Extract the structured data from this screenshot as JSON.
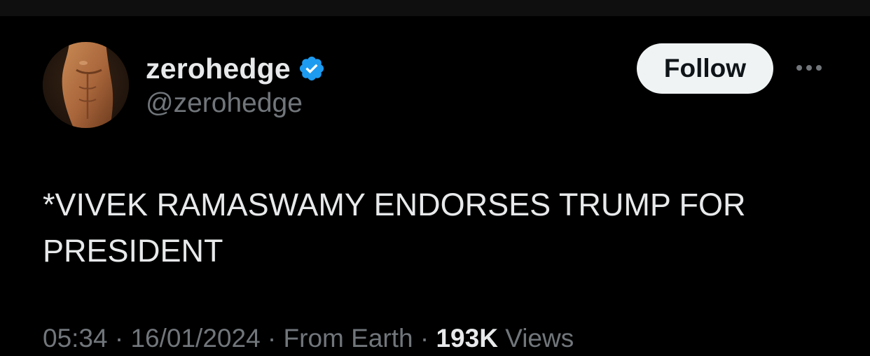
{
  "author": {
    "display_name": "zerohedge",
    "handle": "@zerohedge",
    "verified": true,
    "verified_icon": "verified-badge-icon",
    "verified_color": "#1d9bf0"
  },
  "actions": {
    "follow_label": "Follow",
    "more_icon": "more-horizontal-icon"
  },
  "tweet": {
    "text": "*VIVEK RAMASWAMY ENDORSES TRUMP FOR PRESIDENT",
    "time": "05:34 · 16/01/2024",
    "via": " · From Earth · ",
    "views": "193K",
    "views_label": " Views"
  },
  "colors": {
    "background": "#000000",
    "text": "#e7e9ea",
    "secondary_text": "#71767b",
    "button_bg": "#eff3f4"
  }
}
